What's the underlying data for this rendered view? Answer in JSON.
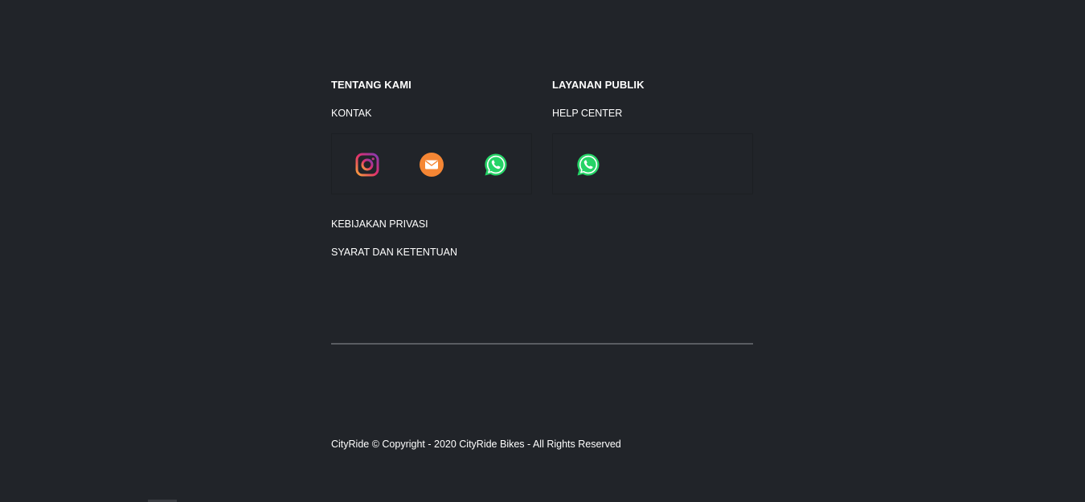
{
  "about": {
    "heading": "TENTANG KAMI",
    "contact_label": "KONTAK",
    "icons": [
      "instagram-icon",
      "email-icon",
      "whatsapp-icon"
    ]
  },
  "public_service": {
    "heading": "LAYANAN PUBLIK",
    "help_label": "HELP CENTER",
    "icons": [
      "whatsapp-icon"
    ]
  },
  "links": {
    "privacy": "KEBIJAKAN PRIVASI",
    "terms": "SYARAT DAN KETENTUAN"
  },
  "footer": {
    "copyright": "CityRide © Copyright - 2020 CityRide Bikes - All Rights Reserved"
  },
  "colors": {
    "background": "#212429",
    "divider": "#5a5d62",
    "instagram": "#c13584",
    "email": "#f58634",
    "whatsapp": "#25d366"
  }
}
